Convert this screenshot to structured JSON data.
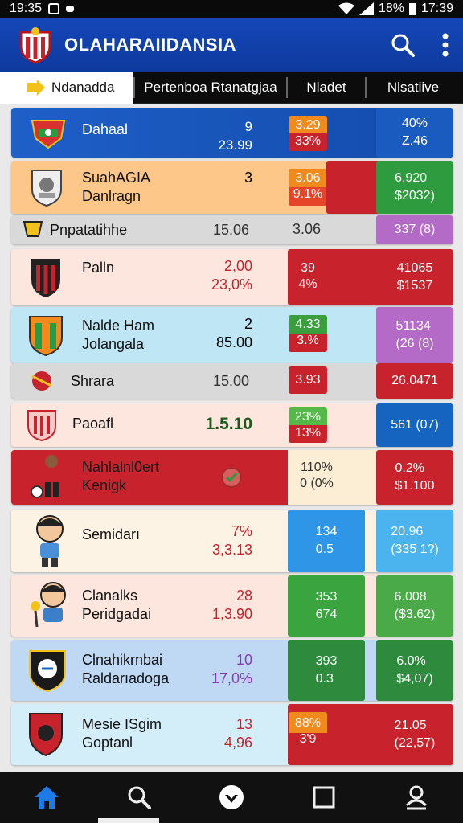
{
  "status_bar": {
    "time_left": "19:35",
    "battery": "18%",
    "time_right": "17:39"
  },
  "app": {
    "title": "OLAHARAIIDANSIA"
  },
  "tabs": [
    {
      "label": "Ndanadda"
    },
    {
      "label": "Pertenboa Rtanatgjaa"
    },
    {
      "label": "Nladet"
    },
    {
      "label": "Nlsatiive"
    }
  ],
  "rows": [
    {
      "name": "Dahaal",
      "nums": "9\n23.99",
      "pill_a": "3.29\n33%",
      "block": "40%\nZ.46"
    },
    {
      "name": "SuahAGIA\nDanlragn",
      "nums": "3",
      "pill_a": "3.06\n9.1%",
      "block": "6.920\n$2032)"
    },
    {
      "name": "Pnpatatihhe",
      "nums": "15.06",
      "plain_b": "3.06",
      "block": "337 (8)"
    },
    {
      "name": "Palln",
      "nums": "2,00\n23,0%",
      "pill_a": "39\n4%",
      "block": "41065\n$1537"
    },
    {
      "name": "Nalde Ham\nJolangala",
      "nums": "2\n85.00",
      "pill_a": "4.33\n3.%",
      "block": "51134\n(26 (8)"
    },
    {
      "name": "Shrara",
      "nums": "15.00",
      "pill_a": "3.93",
      "block": "26.0471"
    },
    {
      "name": "Paoafl",
      "nums": "1.5.10",
      "pill_a": "23%\n13%",
      "block": "561 (07)"
    },
    {
      "name": "Nahlalnl0ert\nKenigk",
      "pill_a": "110%\n0 (0%",
      "block": "0.2%\n$1.100"
    },
    {
      "name": "Semidarı",
      "nums": "7%\n3,3.13",
      "pill_a": "134\n0.5",
      "block": "20.96\n(335 1?)"
    },
    {
      "name": "Clanalks\nPeridgadai",
      "nums": "28\n1,3.90",
      "pill_a": "353\n674",
      "block": "6.008\n($3.62)"
    },
    {
      "name": "Clnahikrnbai\nRaldarıadoga",
      "nums": "10\n17,0%",
      "pill_a": "393\n0.3",
      "block": "6.0%\n$4,07)"
    },
    {
      "name": "Mesie ISgim\nGoptanl",
      "nums": "13\n4,96",
      "pill_a": "88%\n3'9",
      "block": "21.05\n(22,57)"
    }
  ],
  "colors": {
    "app_bar": "#1547b8",
    "red": "#c8232c",
    "green": "#3a9e3f",
    "blue": "#1565c0",
    "purple": "#b36bc7",
    "orange": "#f08a1c"
  },
  "icons": [
    "team-crest-icon",
    "search-icon",
    "more-vert-icon",
    "arrow-icon",
    "home-icon",
    "profile-icon"
  ]
}
